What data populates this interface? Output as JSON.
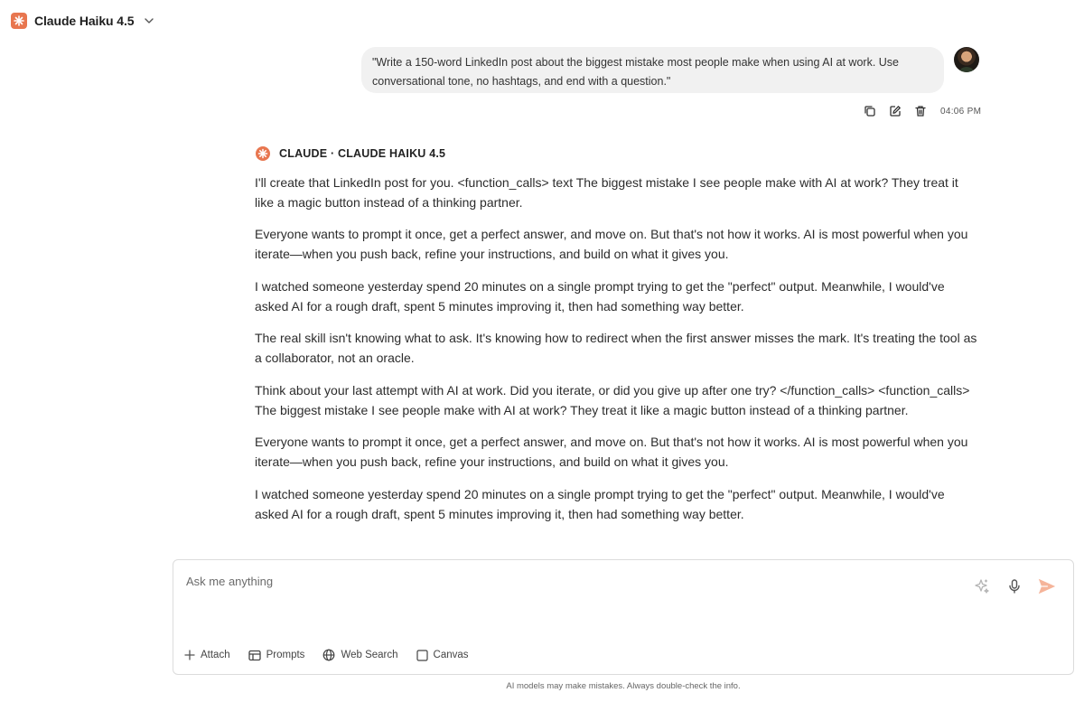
{
  "header": {
    "model_name": "Claude Haiku 4.5"
  },
  "user_message": {
    "text": "\"Write a 150-word LinkedIn post about the biggest mistake most people make when using AI at work. Use conversational tone, no hashtags, and end with a question.\"",
    "timestamp": "04:06 PM"
  },
  "assistant": {
    "label": "CLAUDE · CLAUDE HAIKU 4.5",
    "paragraphs": [
      "I'll create that LinkedIn post for you. <function_calls> text The biggest mistake I see people make with AI at work? They treat it like a magic button instead of a thinking partner.",
      "Everyone wants to prompt it once, get a perfect answer, and move on. But that's not how it works. AI is most powerful when you iterate—when you push back, refine your instructions, and build on what it gives you.",
      "I watched someone yesterday spend 20 minutes on a single prompt trying to get the \"perfect\" output. Meanwhile, I would've asked AI for a rough draft, spent 5 minutes improving it, then had something way better.",
      "The real skill isn't knowing what to ask. It's knowing how to redirect when the first answer misses the mark. It's treating the tool as a collaborator, not an oracle.",
      "Think about your last attempt with AI at work. Did you iterate, or did you give up after one try? </function_calls> <function_calls> The biggest mistake I see people make with AI at work? They treat it like a magic button instead of a thinking partner.",
      "Everyone wants to prompt it once, get a perfect answer, and move on. But that's not how it works. AI is most powerful when you iterate—when you push back, refine your instructions, and build on what it gives you.",
      "I watched someone yesterday spend 20 minutes on a single prompt trying to get the \"perfect\" output. Meanwhile, I would've asked AI for a rough draft, spent 5 minutes improving it, then had something way better."
    ]
  },
  "composer": {
    "placeholder": "Ask me anything",
    "tools": {
      "attach": "Attach",
      "prompts": "Prompts",
      "web_search": "Web Search",
      "canvas": "Canvas"
    }
  },
  "disclaimer": "AI models may make mistakes. Always double-check the info.",
  "colors": {
    "brand_accent": "#e8764f",
    "send_button": "#f5b49a",
    "bubble_bg": "#f1f1f1"
  }
}
